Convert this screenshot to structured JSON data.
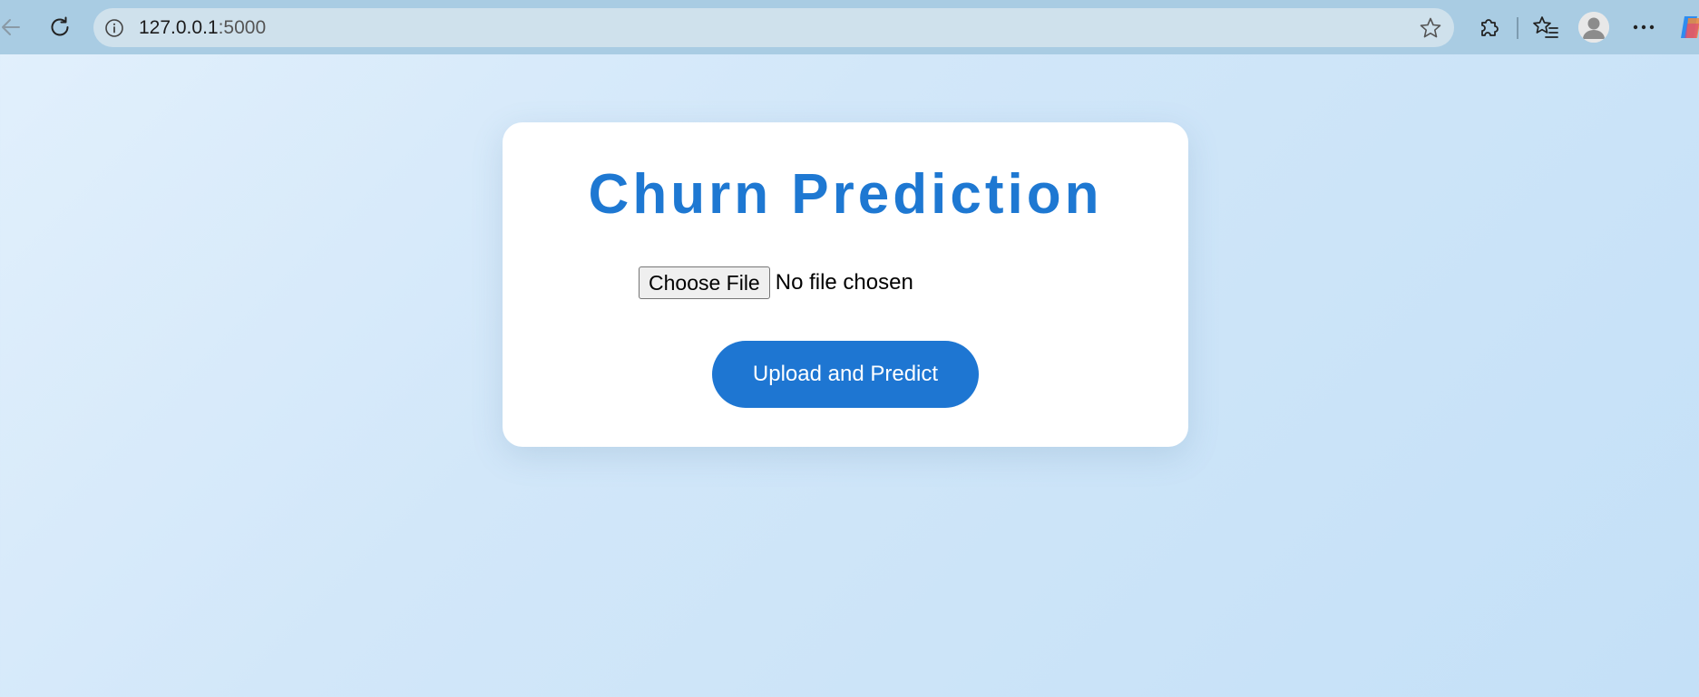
{
  "browser": {
    "url_host": "127.0.0.1",
    "url_port": ":5000",
    "icons": {
      "back": "back-arrow-icon",
      "reload": "reload-icon",
      "site_info": "info-icon",
      "favorite": "star-icon",
      "extensions": "puzzle-icon",
      "favorites": "favorites-list-icon",
      "profile": "avatar",
      "menu": "more-icon",
      "copilot": "copilot-icon"
    }
  },
  "page": {
    "title": "Churn Prediction",
    "file_input": {
      "button_label": "Choose File",
      "status": "No file chosen"
    },
    "submit_label": "Upload and Predict"
  },
  "colors": {
    "accent": "#1e78d2",
    "background_start": "#e2f0fc",
    "background_end": "#c4e0f7",
    "toolbar": "#a9cce3"
  }
}
